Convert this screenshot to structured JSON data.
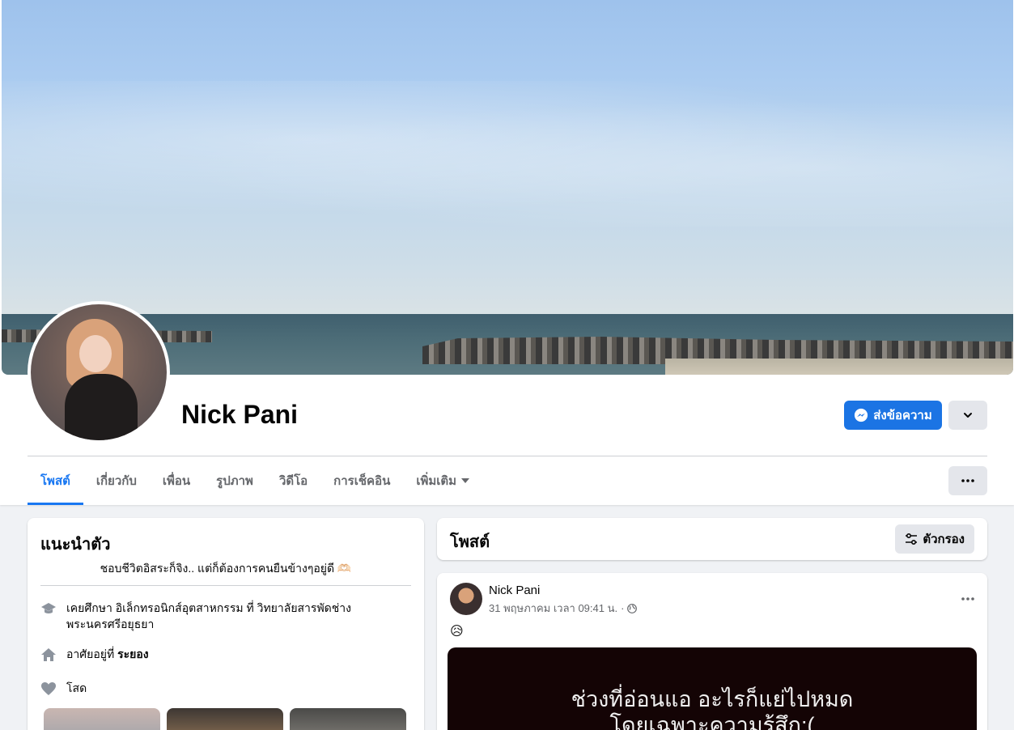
{
  "profile": {
    "name": "Nick Pani",
    "message_button_label": "ส่งข้อความ"
  },
  "tabs": [
    {
      "label": "โพสต์",
      "active": true
    },
    {
      "label": "เกี่ยวกับ",
      "active": false
    },
    {
      "label": "เพื่อน",
      "active": false
    },
    {
      "label": "รูปภาพ",
      "active": false
    },
    {
      "label": "วิดีโอ",
      "active": false
    },
    {
      "label": "การเช็คอิน",
      "active": false
    },
    {
      "label": "เพิ่มเติม",
      "active": false
    }
  ],
  "intro": {
    "title": "แนะนำตัว",
    "bio": "ชอบชีวิตอิสระก็จิง.. แต่ก็ต้องการคนยืนข้างๆอยู่ดี 🫶🏻",
    "education": "เคยศึกษา อิเล็กทรอนิกส์อุตสาหกรรม ที่ วิทยาลัยสารพัดช่าง พระนครศรีอยุธยา",
    "lives_prefix": "อาศัยอยู่ที่ ",
    "lives_place": "ระยอง",
    "relationship": "โสด"
  },
  "posts_section": {
    "title": "โพสต์",
    "filter_label": "ตัวกรอง"
  },
  "post": {
    "author": "Nick Pani",
    "timestamp": "31 พฤษภาคม เวลา 09:41 น.",
    "separator": "·",
    "emoji": "😥",
    "image_text_line1": "ช่วงที่อ่อนแอ อะไรก็แย่ไปหมด",
    "image_text_line2": "โดยเฉพาะความรู้สึก:("
  },
  "colors": {
    "accent": "#1877f2",
    "message_button": "#1b74e4",
    "page_bg": "#f0f2f5",
    "secondary_button": "#e4e6eb"
  },
  "icons": {
    "messenger": "messenger-icon",
    "dropdown": "chevron-down-icon",
    "more": "more-dots-icon",
    "filter": "filter-icon",
    "education": "graduation-cap-icon",
    "home": "home-icon",
    "relationship": "heart-icon",
    "audience": "globe-icon"
  }
}
